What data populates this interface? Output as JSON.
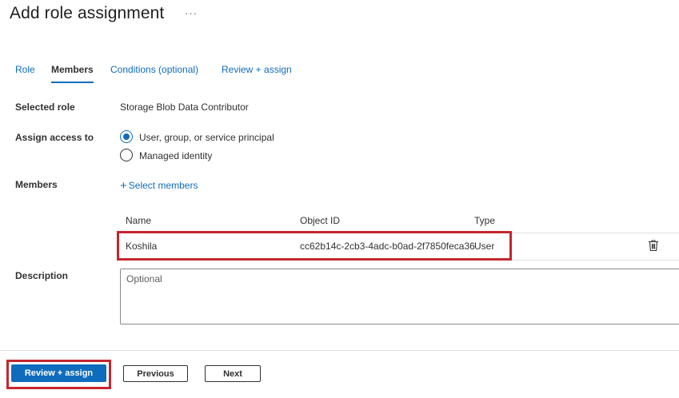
{
  "header": {
    "title": "Add role assignment",
    "more_label": "···"
  },
  "tabs": [
    {
      "label": "Role",
      "active": false
    },
    {
      "label": "Members",
      "active": true
    },
    {
      "label": "Conditions (optional)",
      "active": false
    },
    {
      "label": "Review + assign",
      "active": false
    }
  ],
  "form": {
    "selected_role": {
      "label": "Selected role",
      "value": "Storage Blob Data Contributor"
    },
    "assign_access": {
      "label": "Assign access to",
      "options": [
        {
          "label": "User, group, or service principal",
          "checked": true
        },
        {
          "label": "Managed identity",
          "checked": false
        }
      ]
    },
    "members": {
      "label": "Members",
      "select_link": "Select members",
      "columns": [
        "Name",
        "Object ID",
        "Type"
      ],
      "rows": [
        {
          "name": "Koshila",
          "object_id": "cc62b14c-2cb3-4adc-b0ad-2f7850feca36",
          "type": "User"
        }
      ],
      "row_icon": "trash-icon"
    },
    "description": {
      "label": "Description",
      "placeholder": "Optional",
      "value": ""
    }
  },
  "footer": {
    "review_assign_label": "Review + assign",
    "previous_label": "Previous",
    "next_label": "Next"
  },
  "colors": {
    "accent": "#0f6cbd",
    "highlight_border": "#c4262e",
    "text": "#323130"
  }
}
